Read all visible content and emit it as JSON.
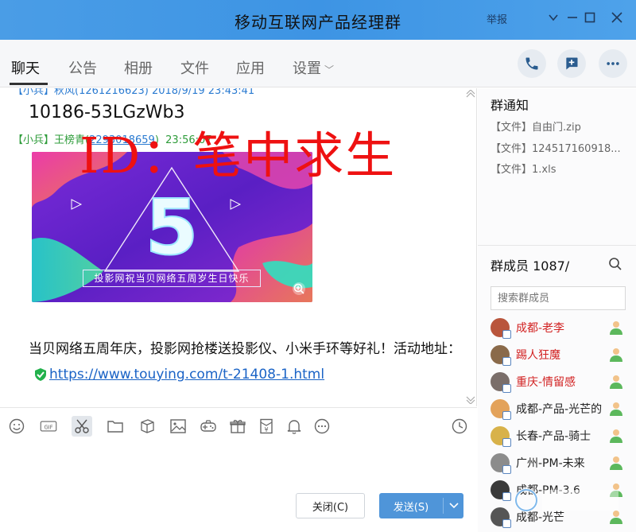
{
  "window": {
    "title": "移动互联网产品经理群",
    "report_label": "举报"
  },
  "tabs": [
    {
      "label": "聊天"
    },
    {
      "label": "公告"
    },
    {
      "label": "相册"
    },
    {
      "label": "文件"
    },
    {
      "label": "应用"
    },
    {
      "label": "设置"
    }
  ],
  "chat": {
    "cut_meta": "【小兵】秋风(1261216623) 2018/9/19 23:43:41",
    "msg1": "10186-53LGzWb3",
    "meta2": {
      "tag": "【小兵】",
      "name": "王榜青(",
      "id": "2293018659",
      "sep": ")",
      "time": "23:56:07"
    },
    "watermark": "ID：笔中求生",
    "banner": {
      "big_text": "5",
      "caption": "投影网祝当贝网络五周岁生日快乐"
    },
    "msg2_text": "当贝网络五周年庆，投影网抢楼送投影仪、小米手环等好礼！活动地址：",
    "msg2_link": "https://www.touying.com/t-21408-1.html"
  },
  "buttons": {
    "close": "关闭(C)",
    "send": "发送(S)"
  },
  "group_notice": {
    "title": "群通知",
    "files": [
      "【文件】自由门.zip",
      "【文件】124517160918...",
      "【文件】1.xls"
    ]
  },
  "members": {
    "title": "群成员 1087/",
    "search_placeholder": "搜索群成员",
    "list": [
      {
        "name": "成都-老李",
        "red": true,
        "color": "#b9553c"
      },
      {
        "name": "踢人狂魔",
        "red": true,
        "color": "#8a6a4a"
      },
      {
        "name": "重庆-情留感",
        "red": true,
        "color": "#7a6e6a"
      },
      {
        "name": "成都-产品-光芒的",
        "red": false,
        "color": "#e3a25a"
      },
      {
        "name": "长春-产品-骑士",
        "red": false,
        "color": "#d8b24a"
      },
      {
        "name": "广州-PM-未来",
        "red": false,
        "color": "#8c8c8c"
      },
      {
        "name": "成都-PM-3.6",
        "red": false,
        "color": "#3a3a3a"
      },
      {
        "name": "成都-光芒",
        "red": false,
        "color": "#555555"
      }
    ]
  },
  "colors": {
    "titlebar": "#4a9de6",
    "accent": "#4f95d9",
    "watermark_red": "#ee1111",
    "admin_red": "#d22222",
    "member_green": "#2e9c3a"
  }
}
